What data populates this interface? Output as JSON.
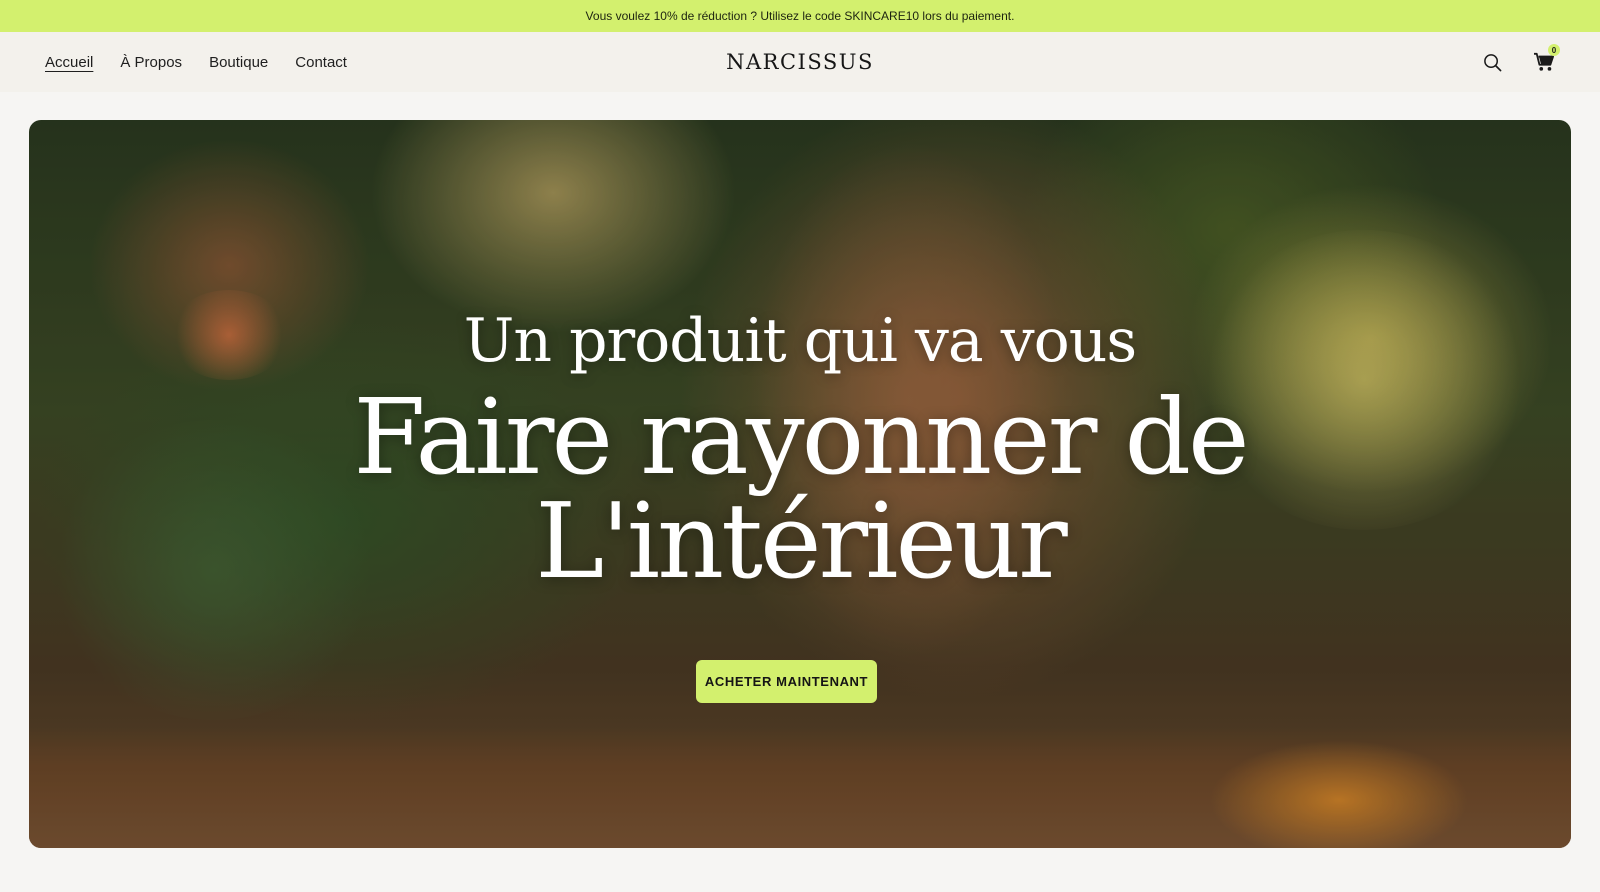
{
  "announcement": {
    "text": "Vous voulez 10% de réduction ? Utilisez le code SKINCARE10 lors du paiement."
  },
  "nav": {
    "items": [
      {
        "label": "Accueil",
        "active": true
      },
      {
        "label": "À Propos"
      },
      {
        "label": "Boutique"
      },
      {
        "label": "Contact"
      }
    ]
  },
  "brand": {
    "name": "NARCISSUS"
  },
  "header_icons": {
    "search": "search-icon",
    "cart": "cart-icon",
    "cart_count": "0"
  },
  "hero": {
    "line1": "Un produit qui va vous",
    "line2": "Faire rayonner de",
    "line3": "L'intérieur",
    "cta_label": "ACHETER MAINTENANT"
  },
  "colors": {
    "accent": "#d3f06e",
    "header_bg": "#f3f1ec",
    "page_bg": "#f6f5f3"
  }
}
